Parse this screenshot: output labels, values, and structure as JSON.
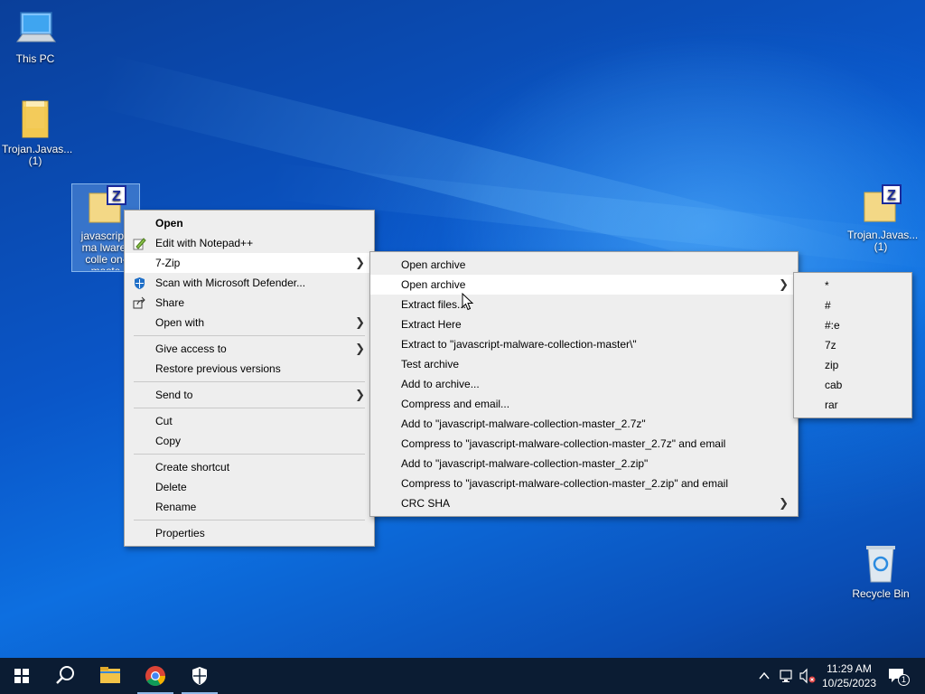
{
  "desktop": {
    "icons": [
      {
        "label": "This PC",
        "glyph": "computer-icon"
      },
      {
        "label": "Trojan.Javas... (1)",
        "glyph": "folder-icon"
      },
      {
        "label": "javascript-malware-collection-master",
        "label_visible": "javascript-ma lware-colle on-maste",
        "glyph": "7zip-archive-icon"
      },
      {
        "label": "Trojan.Javas... (1)",
        "glyph": "7zip-archive-icon"
      },
      {
        "label": "Recycle Bin",
        "glyph": "recycle-bin-icon"
      }
    ]
  },
  "context_menu": {
    "items": [
      {
        "label": "Open",
        "bold": true
      },
      {
        "label": "Edit with Notepad++",
        "icon": "notepadpp-icon"
      },
      {
        "label": "7-Zip",
        "submenu": true,
        "highlighted": true
      },
      {
        "label": "Scan with Microsoft Defender...",
        "icon": "defender-icon"
      },
      {
        "label": "Share",
        "icon": "share-icon"
      },
      {
        "label": "Open with",
        "submenu": true
      },
      {
        "label": "Give access to",
        "submenu": true
      },
      {
        "label": "Restore previous versions"
      },
      {
        "label": "Send to",
        "submenu": true
      },
      {
        "label": "Cut"
      },
      {
        "label": "Copy"
      },
      {
        "label": "Create shortcut"
      },
      {
        "label": "Delete"
      },
      {
        "label": "Rename"
      },
      {
        "label": "Properties"
      }
    ]
  },
  "zip_menu": {
    "items": [
      {
        "label": "Open archive"
      },
      {
        "label": "Open archive",
        "submenu": true,
        "highlighted": true
      },
      {
        "label": "Extract files..."
      },
      {
        "label": "Extract Here"
      },
      {
        "label": "Extract to \"javascript-malware-collection-master\\\""
      },
      {
        "label": "Test archive"
      },
      {
        "label": "Add to archive..."
      },
      {
        "label": "Compress and email..."
      },
      {
        "label": "Add to \"javascript-malware-collection-master_2.7z\""
      },
      {
        "label": "Compress to \"javascript-malware-collection-master_2.7z\" and email"
      },
      {
        "label": "Add to \"javascript-malware-collection-master_2.zip\""
      },
      {
        "label": "Compress to \"javascript-malware-collection-master_2.zip\" and email"
      },
      {
        "label": "CRC SHA",
        "submenu": true
      }
    ]
  },
  "format_menu": {
    "items": [
      "*",
      "#",
      "#:e",
      "7z",
      "zip",
      "cab",
      "rar"
    ]
  },
  "taskbar": {
    "buttons": [
      "windows-start-icon",
      "search-icon",
      "file-explorer-icon",
      "chrome-icon",
      "security-icon"
    ],
    "clock_time": "11:29 AM",
    "clock_date": "10/25/2023",
    "notification_count": "1"
  },
  "colors": {
    "menu_bg": "#eeeeee",
    "menu_highlight": "#ffffff",
    "taskbar_bg": "#0b1c33"
  }
}
